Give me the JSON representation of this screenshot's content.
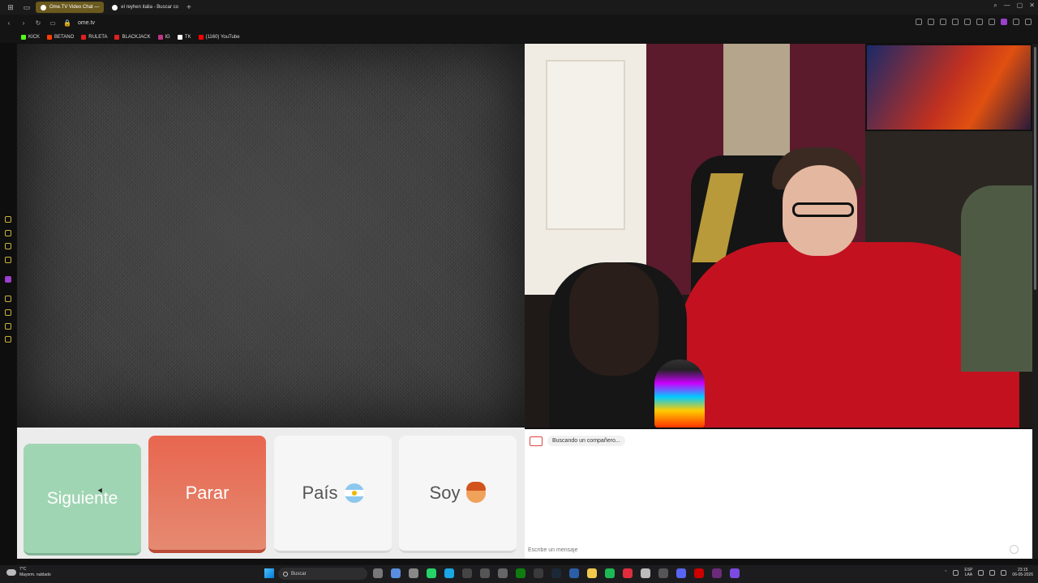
{
  "browser": {
    "tabs": [
      {
        "title": "Ome.TV Video Chat —",
        "active": true
      },
      {
        "title": "el reyhen italia - Buscar co",
        "active": false
      }
    ],
    "address": "ome.tv",
    "bookmarks": [
      {
        "label": "KICK",
        "color": "#53fc18"
      },
      {
        "label": "BETANO",
        "color": "#ff3c00"
      },
      {
        "label": "RULETA",
        "color": "#e02020"
      },
      {
        "label": "BLACKJACK",
        "color": "#e02020"
      },
      {
        "label": "IG",
        "color": "#c13584"
      },
      {
        "label": "TK",
        "color": "#ffffff"
      },
      {
        "label": "(1160) YouTube",
        "color": "#ff0000"
      }
    ]
  },
  "controls": {
    "next_label": "Siguiente",
    "stop_label": "Parar",
    "country_label": "País",
    "me_label": "Soy"
  },
  "chat": {
    "status_message": "Buscando un compañero...",
    "input_placeholder": "Escribe un mensaje"
  },
  "taskbar": {
    "weather_temp": "7°C",
    "weather_desc": "Mayorm. nublado",
    "search_placeholder": "Buscar",
    "lang_line1": "ESP",
    "lang_line2": "LAA",
    "time": "23:15",
    "date": "06-05-2026"
  },
  "colors": {
    "next_button": "#a0d5b3",
    "stop_button": "#e8664f",
    "accent_tab": "#6b5a1e"
  }
}
